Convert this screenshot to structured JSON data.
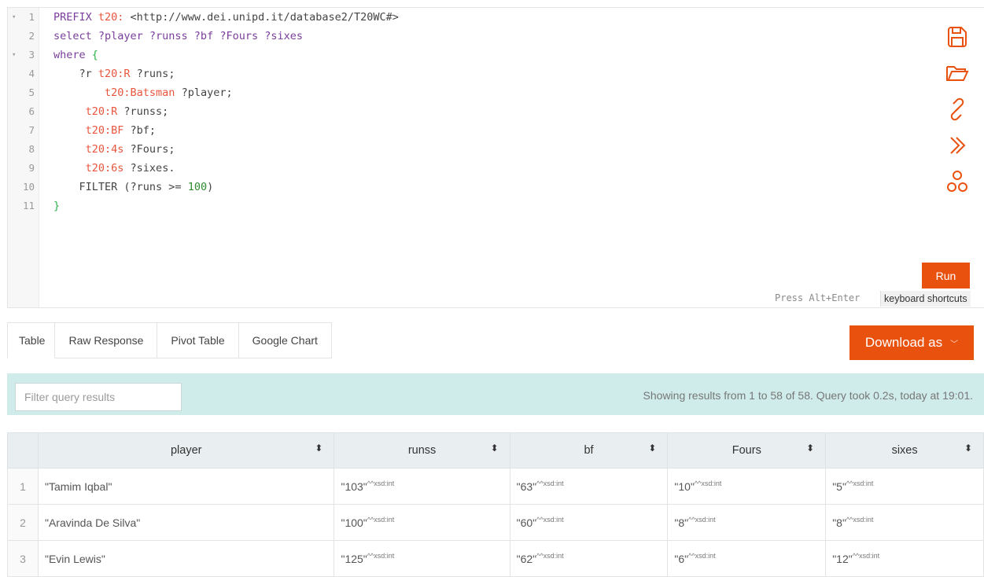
{
  "editor": {
    "line_numbers": [
      "1",
      "2",
      "3",
      "4",
      "5",
      "6",
      "7",
      "8",
      "9",
      "10",
      "11"
    ],
    "fold_marker": "▾",
    "lines": [
      [
        {
          "t": "PREFIX ",
          "c": "k"
        },
        {
          "t": "t20:",
          "c": "p"
        },
        {
          "t": " <http://www.dei.unipd.it/database2/T20WC#>",
          "c": "u"
        }
      ],
      [
        {
          "t": "select ?player ?runss ?bf ?Fours ?sixes",
          "c": "k"
        }
      ],
      [
        {
          "t": "where ",
          "c": "k"
        },
        {
          "t": "{",
          "c": "b"
        }
      ],
      [
        {
          "t": "    ?r ",
          "c": "v"
        },
        {
          "t": "t20:R",
          "c": "p"
        },
        {
          "t": " ?runs;",
          "c": "v"
        }
      ],
      [
        {
          "t": "        ",
          "c": "v"
        },
        {
          "t": "t20:Batsman",
          "c": "p"
        },
        {
          "t": " ?player;",
          "c": "v"
        }
      ],
      [
        {
          "t": "     ",
          "c": "v"
        },
        {
          "t": "t20:R",
          "c": "p"
        },
        {
          "t": " ?runss;",
          "c": "v"
        }
      ],
      [
        {
          "t": "     ",
          "c": "v"
        },
        {
          "t": "t20:BF",
          "c": "p"
        },
        {
          "t": " ?bf;",
          "c": "v"
        }
      ],
      [
        {
          "t": "     ",
          "c": "v"
        },
        {
          "t": "t20:4s",
          "c": "p"
        },
        {
          "t": " ?Fours;",
          "c": "v"
        }
      ],
      [
        {
          "t": "     ",
          "c": "v"
        },
        {
          "t": "t20:6s",
          "c": "p"
        },
        {
          "t": " ?sixes.",
          "c": "v"
        }
      ],
      [
        {
          "t": "    FILTER (?runs >= ",
          "c": "v"
        },
        {
          "t": "100",
          "c": "n"
        },
        {
          "t": ")",
          "c": "v"
        }
      ],
      [
        {
          "t": "}",
          "c": "b"
        }
      ]
    ]
  },
  "side_icons": [
    "save-icon",
    "folder-open-icon",
    "link-icon",
    "double-chevron-right-icon",
    "share-nodes-icon"
  ],
  "run_label": "Run",
  "hint_text": "Press Alt+Enter",
  "keyboard_shortcuts_label": "keyboard shortcuts",
  "tabs": [
    "Table",
    "Raw Response",
    "Pivot Table",
    "Google Chart"
  ],
  "download_label": "Download as",
  "filter": {
    "placeholder": "Filter query results"
  },
  "status_text": "Showing results from 1 to 58 of 58. Query took 0.2s, today at 19:01.",
  "table": {
    "columns": [
      "player",
      "runss",
      "bf",
      "Fours",
      "sixes"
    ],
    "sort_icon": "⬍",
    "datatype": "^^xsd:int",
    "rows": [
      {
        "idx": "1",
        "player": "\"Tamim Iqbal\"",
        "runss": "\"103\"",
        "bf": "\"63\"",
        "Fours": "\"10\"",
        "sixes": "\"5\""
      },
      {
        "idx": "2",
        "player": "\"Aravinda De Silva\"",
        "runss": "\"100\"",
        "bf": "\"60\"",
        "Fours": "\"8\"",
        "sixes": "\"8\""
      },
      {
        "idx": "3",
        "player": "\"Evin Lewis\"",
        "runss": "\"125\"",
        "bf": "\"62\"",
        "Fours": "\"6\"",
        "sixes": "\"12\""
      }
    ]
  },
  "colors": {
    "accent": "#e8520e",
    "filter_bg": "#cfecea",
    "header_bg": "#e9eef0"
  }
}
